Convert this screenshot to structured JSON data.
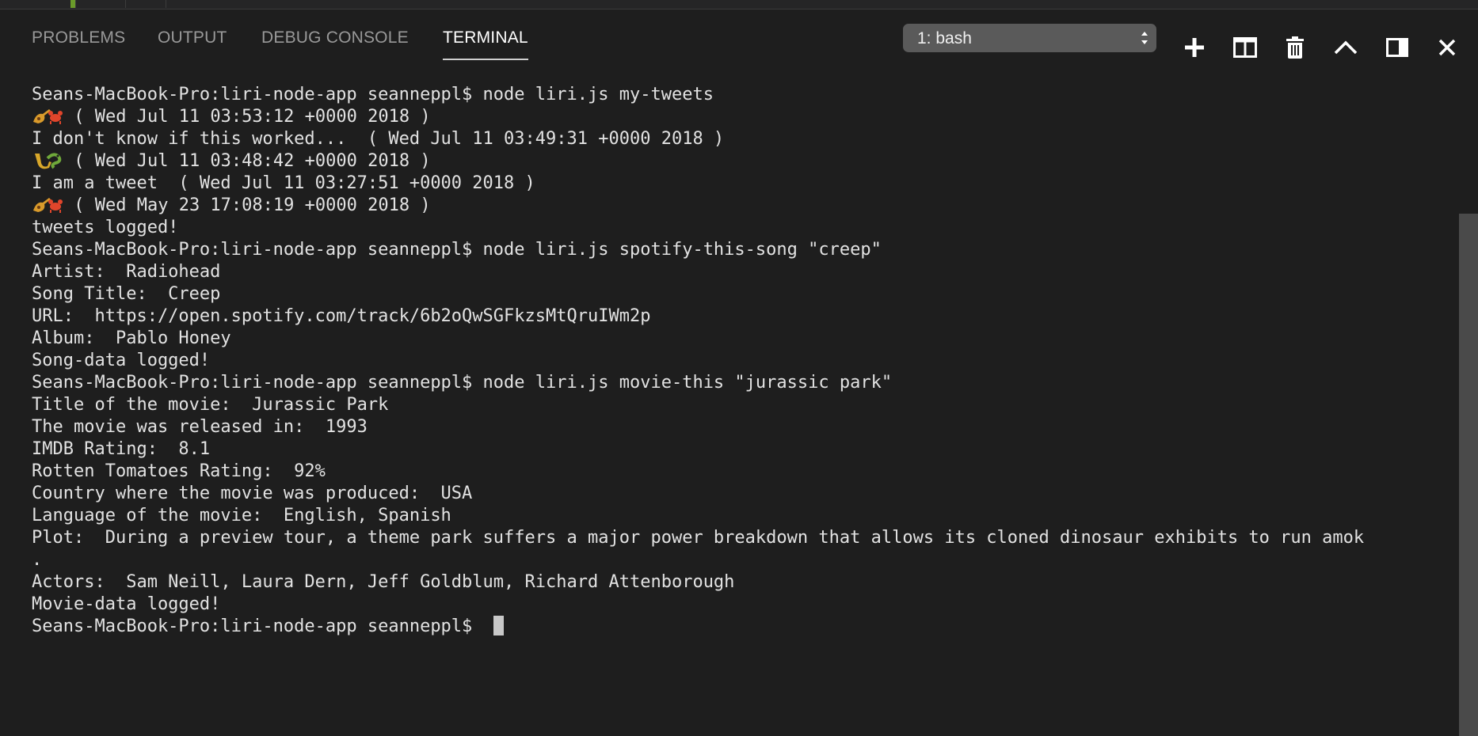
{
  "panel": {
    "tabs": [
      {
        "label": "PROBLEMS"
      },
      {
        "label": "OUTPUT"
      },
      {
        "label": "DEBUG CONSOLE"
      },
      {
        "label": "TERMINAL"
      }
    ],
    "active_tab": "TERMINAL",
    "terminal_select": {
      "value": "1: bash"
    }
  },
  "icons": [
    "plus-icon",
    "split-icon",
    "trash-icon",
    "chevron-up-icon",
    "toggle-panel-icon",
    "close-icon"
  ],
  "terminal": {
    "lines": [
      "Seans-MacBook-Pro:liri-node-app seanneppl$ node liri.js my-tweets",
      " ( Wed Jul 11 03:53:12 +0000 2018 )",
      "I don't know if this worked...  ( Wed Jul 11 03:49:31 +0000 2018 )",
      " ( Wed Jul 11 03:48:42 +0000 2018 )",
      "I am a tweet  ( Wed Jul 11 03:27:51 +0000 2018 )",
      " ( Wed May 23 17:08:19 +0000 2018 )",
      "tweets logged!",
      "Seans-MacBook-Pro:liri-node-app seanneppl$ node liri.js spotify-this-song \"creep\"",
      "Artist:  Radiohead",
      "Song Title:  Creep",
      "URL:  https://open.spotify.com/track/6b2oQwSGFkzsMtQruIWm2p",
      "Album:  Pablo Honey",
      "Song-data logged!",
      "Seans-MacBook-Pro:liri-node-app seanneppl$ node liri.js movie-this \"jurassic park\"",
      "Title of the movie:  Jurassic Park",
      "The movie was released in:  1993",
      "IMDB Rating:  8.1",
      "Rotten Tomatoes Rating:  92%",
      "Country where the movie was produced:  USA",
      "Language of the movie:  English, Spanish",
      "Plot:  During a preview tour, a theme park suffers a major power breakdown that allows its cloned dinosaur exhibits to run amok",
      ".",
      "Actors:  Sam Neill, Laura Dern, Jeff Goldblum, Richard Attenborough",
      "Movie-data logged!",
      "Seans-MacBook-Pro:liri-node-app seanneppl$ "
    ],
    "emoji_lines": [
      1,
      3,
      5
    ]
  },
  "colors": {
    "background": "#1e1e1e",
    "text": "#e2e2e2",
    "tab_inactive": "#999999",
    "tab_active": "#ffffff",
    "select_bg": "#5a5a5a"
  }
}
